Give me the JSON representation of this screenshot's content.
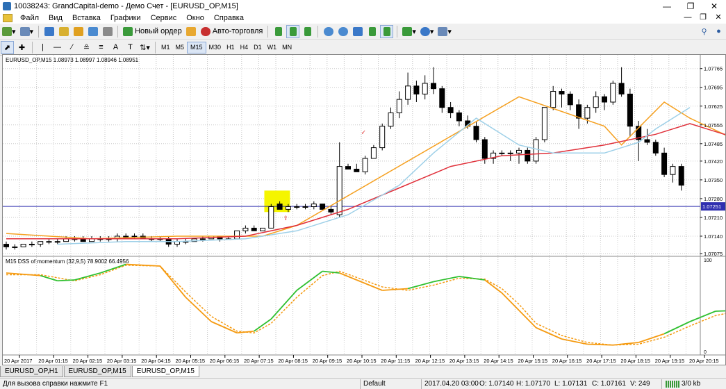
{
  "window": {
    "title": "10038243: GrandCapital-demo - Демо Счет - [EURUSD_OP,M15]"
  },
  "menu": [
    "Файл",
    "Вид",
    "Вставка",
    "Графики",
    "Сервис",
    "Окно",
    "Справка"
  ],
  "toolbar": {
    "new_order": "Новый ордер",
    "auto_trading": "Авто-торговля",
    "timeframes": [
      "M1",
      "M5",
      "M15",
      "M30",
      "H1",
      "H4",
      "D1",
      "W1",
      "MN"
    ],
    "active_timeframe": "M15",
    "text_tool": "A"
  },
  "chart": {
    "header": "EURUSD_OP,M15  1.08973 1.08997 1.08946 1.08951",
    "price_labels": [
      "1.07765",
      "1.07695",
      "1.07625",
      "1.07555",
      "1.07485",
      "1.07420",
      "1.07350",
      "1.07280",
      "1.07210",
      "1.07140",
      "1.07075"
    ],
    "current_price": "1.07251",
    "indicator_header": "M15 DSS of momentum (32,9,5) 78.9002 66.4956",
    "indicator_scale": [
      "100",
      "0"
    ],
    "time_labels": [
      "20 Apr 2017",
      "20 Apr 01:15",
      "20 Apr 02:15",
      "20 Apr 03:15",
      "20 Apr 04:15",
      "20 Apr 05:15",
      "20 Apr 06:15",
      "20 Apr 07:15",
      "20 Apr 08:15",
      "20 Apr 09:15",
      "20 Apr 10:15",
      "20 Apr 11:15",
      "20 Apr 12:15",
      "20 Apr 13:15",
      "20 Apr 14:15",
      "20 Apr 15:15",
      "20 Apr 16:15",
      "20 Apr 17:15",
      "20 Apr 18:15",
      "20 Apr 19:15",
      "20 Apr 20:15"
    ],
    "colors": {
      "up_candle": "#ffffff",
      "down_candle": "#000000",
      "ma_orange": "#f5a020",
      "ma_red": "#e0303a",
      "ma_lightblue": "#9ed0e8",
      "price_line": "#3030b0",
      "dss_green": "#30c030",
      "dss_orange": "#f59a10",
      "highlight": "#f5f500"
    }
  },
  "chart_data": {
    "type": "candlestick",
    "ylim": [
      1.0707,
      1.07785
    ],
    "candles": [
      [
        1.0711,
        1.0712,
        1.0709,
        1.071
      ],
      [
        1.071,
        1.0711,
        1.0709,
        1.071
      ],
      [
        1.071,
        1.0711,
        1.071,
        1.0711
      ],
      [
        1.0711,
        1.0712,
        1.071,
        1.0711
      ],
      [
        1.0711,
        1.0712,
        1.071,
        1.0712
      ],
      [
        1.0712,
        1.0713,
        1.0711,
        1.0712
      ],
      [
        1.0712,
        1.0713,
        1.0711,
        1.0712
      ],
      [
        1.0712,
        1.0714,
        1.0712,
        1.0713
      ],
      [
        1.0713,
        1.0714,
        1.0712,
        1.0713
      ],
      [
        1.0713,
        1.0714,
        1.0712,
        1.0712
      ],
      [
        1.0712,
        1.0714,
        1.0712,
        1.0713
      ],
      [
        1.0713,
        1.0714,
        1.0712,
        1.0713
      ],
      [
        1.0713,
        1.0714,
        1.0712,
        1.0713
      ],
      [
        1.0713,
        1.0715,
        1.0712,
        1.0714
      ],
      [
        1.0714,
        1.0715,
        1.0713,
        1.0714
      ],
      [
        1.0714,
        1.0715,
        1.0713,
        1.0714
      ],
      [
        1.0714,
        1.0715,
        1.0713,
        1.0713
      ],
      [
        1.0713,
        1.0714,
        1.0712,
        1.0713
      ],
      [
        1.0713,
        1.0714,
        1.0712,
        1.0713
      ],
      [
        1.0713,
        1.0714,
        1.071,
        1.0711
      ],
      [
        1.0711,
        1.0713,
        1.071,
        1.0712
      ],
      [
        1.0712,
        1.0713,
        1.0711,
        1.0712
      ],
      [
        1.0712,
        1.0713,
        1.0712,
        1.0713
      ],
      [
        1.0713,
        1.0714,
        1.0712,
        1.0713
      ],
      [
        1.0713,
        1.0714,
        1.0713,
        1.0714
      ],
      [
        1.0714,
        1.0714,
        1.0712,
        1.0713
      ],
      [
        1.0713,
        1.0714,
        1.0713,
        1.0713
      ],
      [
        1.0713,
        1.0716,
        1.0713,
        1.0716
      ],
      [
        1.0716,
        1.0718,
        1.0715,
        1.0717
      ],
      [
        1.0717,
        1.0718,
        1.0716,
        1.0716
      ],
      [
        1.0716,
        1.0717,
        1.0716,
        1.0717
      ],
      [
        1.0717,
        1.0726,
        1.0717,
        1.0725
      ],
      [
        1.0726,
        1.0727,
        1.0724,
        1.0724
      ],
      [
        1.0724,
        1.0726,
        1.0723,
        1.0725
      ],
      [
        1.0725,
        1.0726,
        1.0724,
        1.0725
      ],
      [
        1.0725,
        1.0726,
        1.0724,
        1.0725
      ],
      [
        1.0725,
        1.0727,
        1.0724,
        1.0726
      ],
      [
        1.0726,
        1.0726,
        1.0724,
        1.0724
      ],
      [
        1.0724,
        1.0725,
        1.0722,
        1.0723
      ],
      [
        1.0722,
        1.0749,
        1.0721,
        1.074
      ],
      [
        1.074,
        1.0741,
        1.0739,
        1.0739
      ],
      [
        1.0739,
        1.0741,
        1.0738,
        1.0738
      ],
      [
        1.0738,
        1.0744,
        1.0737,
        1.0743
      ],
      [
        1.0743,
        1.0748,
        1.0743,
        1.0747
      ],
      [
        1.0747,
        1.0756,
        1.0746,
        1.0755
      ],
      [
        1.0755,
        1.0762,
        1.0754,
        1.076
      ],
      [
        1.076,
        1.0768,
        1.0758,
        1.0765
      ],
      [
        1.0765,
        1.0775,
        1.0763,
        1.077
      ],
      [
        1.077,
        1.0772,
        1.0764,
        1.0767
      ],
      [
        1.0767,
        1.0774,
        1.0765,
        1.0771
      ],
      [
        1.0771,
        1.0777,
        1.0767,
        1.0769
      ],
      [
        1.0769,
        1.077,
        1.076,
        1.0762
      ],
      [
        1.0762,
        1.0764,
        1.0758,
        1.076
      ],
      [
        1.076,
        1.0761,
        1.0755,
        1.0757
      ],
      [
        1.0757,
        1.0759,
        1.0754,
        1.0755
      ],
      [
        1.0755,
        1.0757,
        1.0749,
        1.075
      ],
      [
        1.075,
        1.0751,
        1.0741,
        1.0743
      ],
      [
        1.0743,
        1.0746,
        1.0741,
        1.0745
      ],
      [
        1.0745,
        1.0746,
        1.0744,
        1.0745
      ],
      [
        1.0745,
        1.0746,
        1.0742,
        1.0745
      ],
      [
        1.0745,
        1.0747,
        1.0741,
        1.0746
      ],
      [
        1.0746,
        1.0747,
        1.0741,
        1.0742
      ],
      [
        1.0742,
        1.0751,
        1.0741,
        1.075
      ],
      [
        1.075,
        1.0762,
        1.0749,
        1.0762
      ],
      [
        1.0762,
        1.077,
        1.0761,
        1.0768
      ],
      [
        1.0768,
        1.0769,
        1.0762,
        1.0767
      ],
      [
        1.0767,
        1.0768,
        1.0761,
        1.0763
      ],
      [
        1.0763,
        1.0765,
        1.0754,
        1.0758
      ],
      [
        1.0758,
        1.0763,
        1.0756,
        1.0762
      ],
      [
        1.0762,
        1.0768,
        1.076,
        1.0766
      ],
      [
        1.0766,
        1.0767,
        1.0761,
        1.0764
      ],
      [
        1.0764,
        1.0772,
        1.0763,
        1.0771
      ],
      [
        1.0771,
        1.0777,
        1.0766,
        1.0767
      ],
      [
        1.0767,
        1.0769,
        1.0751,
        1.0755
      ],
      [
        1.0755,
        1.0757,
        1.0742,
        1.075
      ],
      [
        1.075,
        1.0754,
        1.0748,
        1.0749
      ],
      [
        1.0749,
        1.075,
        1.0744,
        1.0745
      ],
      [
        1.0745,
        1.0747,
        1.0736,
        1.0737
      ],
      [
        1.0737,
        1.0741,
        1.0734,
        1.074
      ],
      [
        1.074,
        1.0741,
        1.0731,
        1.0733
      ]
    ],
    "ma_orange": [
      [
        0,
        1.0715
      ],
      [
        10,
        1.0713
      ],
      [
        20,
        1.0714
      ],
      [
        30,
        1.0714
      ],
      [
        34,
        1.0718
      ],
      [
        60,
        1.0766
      ],
      [
        70,
        1.0755
      ],
      [
        72,
        1.0748
      ],
      [
        77,
        1.0764
      ],
      [
        80,
        1.0758
      ],
      [
        84,
        1.0752
      ],
      [
        88,
        1.0743
      ]
    ],
    "ma_red": [
      [
        0,
        1.0713
      ],
      [
        10,
        1.0713
      ],
      [
        20,
        1.0713
      ],
      [
        28,
        1.0714
      ],
      [
        34,
        1.0718
      ],
      [
        40,
        1.0724
      ],
      [
        46,
        1.0732
      ],
      [
        52,
        1.074
      ],
      [
        58,
        1.0744
      ],
      [
        64,
        1.0745
      ],
      [
        70,
        1.0748
      ],
      [
        76,
        1.0752
      ],
      [
        80,
        1.0756
      ],
      [
        84,
        1.0752
      ],
      [
        88,
        1.0752
      ]
    ],
    "ma_lightblue": [
      [
        6,
        1.0711
      ],
      [
        14,
        1.0712
      ],
      [
        20,
        1.0712
      ],
      [
        28,
        1.0713
      ],
      [
        34,
        1.0716
      ],
      [
        40,
        1.0722
      ],
      [
        46,
        1.0733
      ],
      [
        50,
        1.0745
      ],
      [
        55,
        1.0758
      ],
      [
        60,
        1.0748
      ],
      [
        64,
        1.0745
      ],
      [
        70,
        1.0745
      ],
      [
        74,
        1.0749
      ],
      [
        76,
        1.0754
      ],
      [
        80,
        1.0762
      ]
    ],
    "dss_main": [
      [
        0,
        88
      ],
      [
        4,
        85
      ],
      [
        6,
        79
      ],
      [
        8,
        80
      ],
      [
        11,
        88
      ],
      [
        14,
        98
      ],
      [
        18,
        96
      ],
      [
        21,
        60
      ],
      [
        24,
        32
      ],
      [
        27,
        19
      ],
      [
        29,
        21
      ],
      [
        31,
        35
      ],
      [
        34,
        68
      ],
      [
        37,
        90
      ],
      [
        39,
        88
      ],
      [
        41,
        80
      ],
      [
        44,
        68
      ],
      [
        47,
        70
      ],
      [
        50,
        78
      ],
      [
        53,
        84
      ],
      [
        56,
        80
      ],
      [
        58,
        65
      ],
      [
        60,
        45
      ],
      [
        62,
        25
      ],
      [
        65,
        12
      ],
      [
        68,
        6
      ],
      [
        71,
        5
      ],
      [
        74,
        8
      ],
      [
        77,
        18
      ],
      [
        80,
        32
      ],
      [
        83,
        44
      ],
      [
        86,
        45
      ],
      [
        89,
        38
      ],
      [
        91,
        27
      ]
    ],
    "dss_signal": [
      [
        0,
        86
      ],
      [
        4,
        86
      ],
      [
        8,
        79
      ],
      [
        11,
        86
      ],
      [
        14,
        97
      ],
      [
        18,
        96
      ],
      [
        21,
        66
      ],
      [
        24,
        38
      ],
      [
        27,
        21
      ],
      [
        29,
        19
      ],
      [
        31,
        30
      ],
      [
        34,
        60
      ],
      [
        37,
        85
      ],
      [
        39,
        90
      ],
      [
        41,
        83
      ],
      [
        44,
        72
      ],
      [
        47,
        68
      ],
      [
        50,
        74
      ],
      [
        53,
        82
      ],
      [
        56,
        81
      ],
      [
        58,
        70
      ],
      [
        60,
        52
      ],
      [
        62,
        30
      ],
      [
        65,
        16
      ],
      [
        68,
        8
      ],
      [
        71,
        5
      ],
      [
        74,
        6
      ],
      [
        77,
        14
      ],
      [
        80,
        27
      ],
      [
        83,
        39
      ],
      [
        86,
        45
      ],
      [
        89,
        41
      ],
      [
        91,
        31
      ]
    ],
    "dss_green_ranges": [
      [
        4,
        15
      ],
      [
        30,
        39
      ],
      [
        46,
        56
      ],
      [
        76,
        88
      ]
    ]
  },
  "tabs": [
    "EURUSD_OP,H1",
    "EURUSD_OP,M15",
    "EURUSD_OP,M15"
  ],
  "active_tab_index": 2,
  "status": {
    "help": "Для вызова справки нажмите F1",
    "profile": "Default",
    "datetime": "2017.04.20 03:00",
    "open": "O: 1.07140",
    "high": "H: 1.07170",
    "low": "L: 1.07131",
    "close": "C: 1.07161",
    "volume": "V: 249",
    "traffic": "3/0 kb"
  }
}
